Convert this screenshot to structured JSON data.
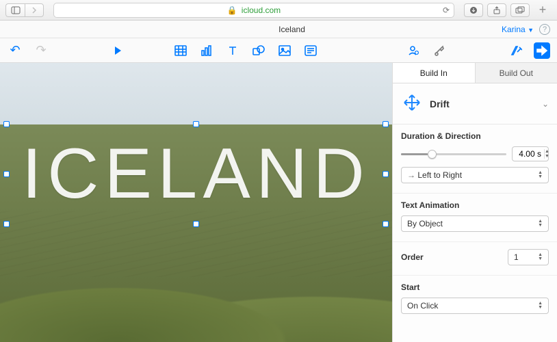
{
  "browser": {
    "url": "icloud.com"
  },
  "document": {
    "title": "Iceland",
    "user": "Karina"
  },
  "slide": {
    "headline": "ICELAND"
  },
  "inspector": {
    "tabs": {
      "build_in": "Build In",
      "build_out": "Build Out"
    },
    "effect": {
      "name": "Drift"
    },
    "duration_section": "Duration & Direction",
    "duration_value": "4.00 s",
    "direction_value": "Left to Right",
    "text_anim_section": "Text Animation",
    "text_anim_value": "By Object",
    "order_label": "Order",
    "order_value": "1",
    "start_label": "Start",
    "start_value": "On Click"
  }
}
